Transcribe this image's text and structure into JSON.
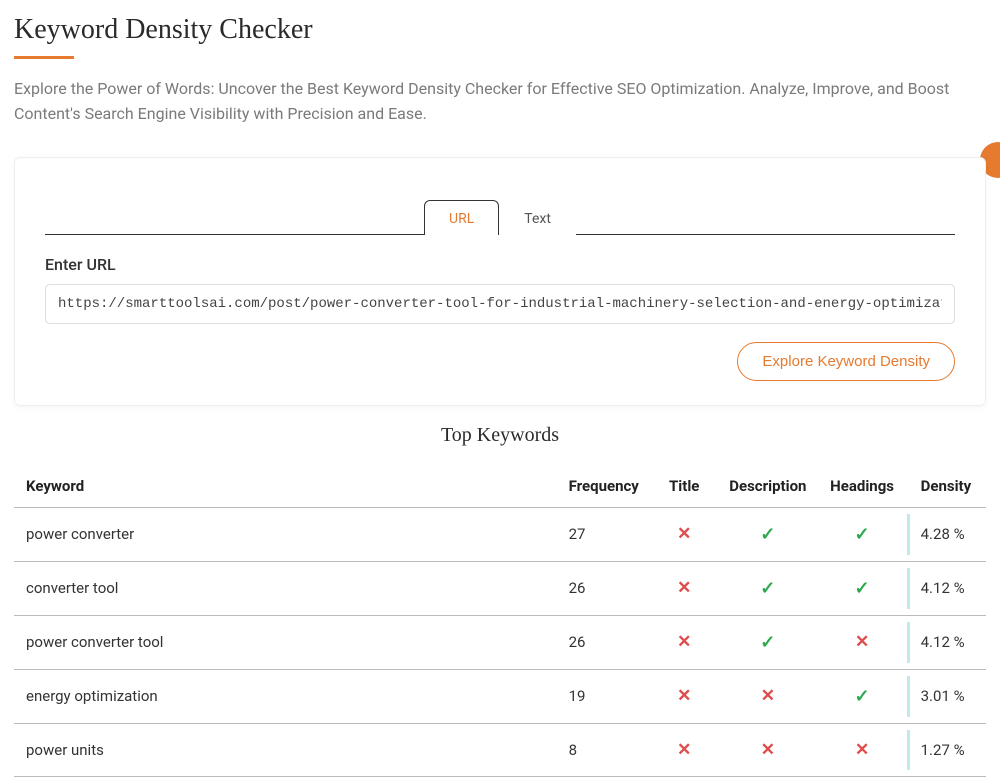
{
  "header": {
    "title": "Keyword Density Checker",
    "subtitle": "Explore the Power of Words: Uncover the Best Keyword Density Checker for Effective SEO Optimization. Analyze, Improve, and Boost Content's Search Engine Visibility with Precision and Ease."
  },
  "tabs": {
    "url": "URL",
    "text": "Text",
    "active": "url"
  },
  "form": {
    "label": "Enter URL",
    "value": "https://smarttoolsai.com/post/power-converter-tool-for-industrial-machinery-selection-and-energy-optimization",
    "button": "Explore Keyword Density"
  },
  "results": {
    "section_title": "Top Keywords",
    "columns": {
      "keyword": "Keyword",
      "frequency": "Frequency",
      "title": "Title",
      "description": "Description",
      "headings": "Headings",
      "density": "Density"
    },
    "rows": [
      {
        "keyword": "power converter",
        "frequency": "27",
        "title": false,
        "description": true,
        "headings": true,
        "density": "4.28 %"
      },
      {
        "keyword": "converter tool",
        "frequency": "26",
        "title": false,
        "description": true,
        "headings": true,
        "density": "4.12 %"
      },
      {
        "keyword": "power converter tool",
        "frequency": "26",
        "title": false,
        "description": true,
        "headings": false,
        "density": "4.12 %"
      },
      {
        "keyword": "energy optimization",
        "frequency": "19",
        "title": false,
        "description": false,
        "headings": true,
        "density": "3.01 %"
      },
      {
        "keyword": "power units",
        "frequency": "8",
        "title": false,
        "description": false,
        "headings": false,
        "density": "1.27 %"
      }
    ]
  },
  "icons": {
    "check": "✓",
    "cross": "✕"
  }
}
